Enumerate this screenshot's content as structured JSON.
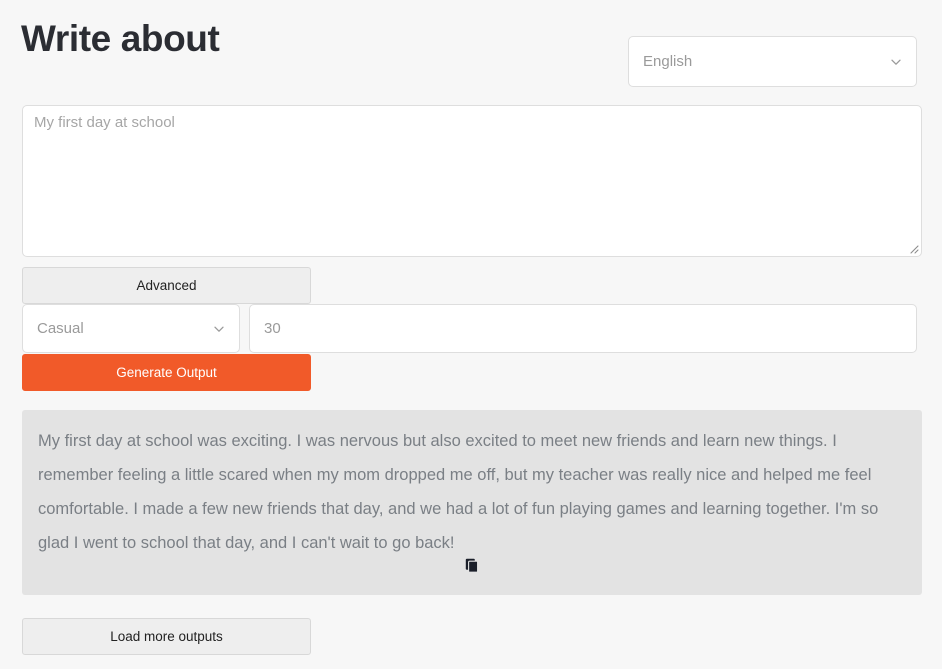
{
  "header": {
    "title": "Write about",
    "language_select": {
      "value": "English",
      "icon": "chevron-down-icon"
    }
  },
  "prompt": {
    "placeholder": "My first day at school",
    "value": "",
    "resize_handle_icon": "resize-grip-icon"
  },
  "controls": {
    "advanced_label": "Advanced",
    "tone_select": {
      "value": "Casual",
      "icon": "chevron-down-icon"
    },
    "length_input": {
      "placeholder": "30",
      "value": ""
    },
    "generate_label": "Generate Output",
    "generate_color": "#f15a29"
  },
  "output": {
    "text": "My first day at school was exciting. I was nervous but also excited to meet new friends and learn new things. I remember feeling a little scared when my mom dropped me off, but my teacher was really nice and helped me feel comfortable. I made a few new friends that day, and we had a lot of fun playing games and learning together. I'm so glad I went to school that day, and I can't wait to go back!",
    "copy_icon": "copy-icon",
    "background_color": "#e3e3e3"
  },
  "footer": {
    "load_more_label": "Load more outputs"
  }
}
